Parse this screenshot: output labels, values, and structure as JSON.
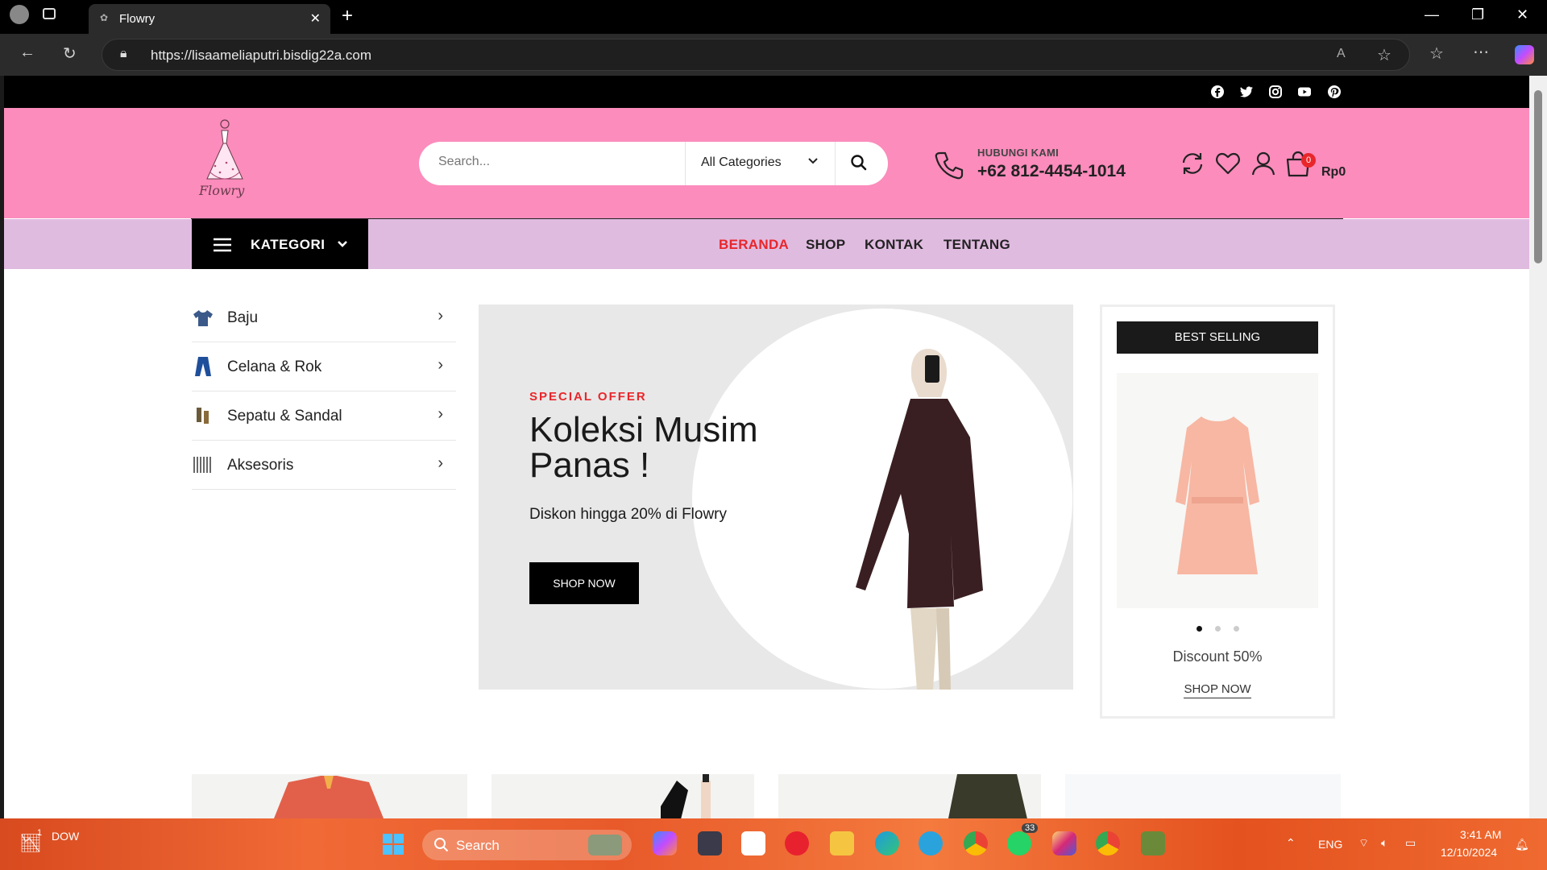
{
  "browser": {
    "tab_title": "Flowry",
    "url": "https://lisaameliaputri.bisdig22a.com"
  },
  "social": [
    "facebook-icon",
    "twitter-icon",
    "instagram-icon",
    "youtube-icon",
    "pinterest-icon"
  ],
  "header": {
    "logo_text": "Flowry",
    "search_placeholder": "Search...",
    "category_select": "All Categories",
    "contact_label": "HUBUNGI KAMI",
    "contact_phone": "+62 812-4454-1014",
    "cart_count": "0",
    "cart_total": "Rp0"
  },
  "nav": {
    "kategori_label": "KATEGORI",
    "menu": [
      "BERANDA",
      "SHOP",
      "KONTAK",
      "TENTANG"
    ]
  },
  "categories": [
    "Baju",
    "Celana & Rok",
    "Sepatu & Sandal",
    "Aksesoris"
  ],
  "hero": {
    "kicker": "SPECIAL OFFER",
    "title": "Koleksi Musim Panas !",
    "subtitle": "Diskon hingga 20% di Flowry",
    "button": "SHOP NOW"
  },
  "best_selling": {
    "heading": "BEST SELLING",
    "discount": "Discount 50%",
    "link": "SHOP NOW",
    "slides": 3,
    "active_slide": 1
  },
  "taskbar": {
    "weather_badge": "1",
    "widget_text": "DOW",
    "search_label": "Search",
    "whatsapp_badge": "33",
    "language": "ENG",
    "time": "3:41 AM",
    "date": "12/10/2024"
  },
  "colors": {
    "header_pink": "#fb8cbc",
    "nav_lilac": "#e0bbe0",
    "accent_red": "#e8262b"
  }
}
